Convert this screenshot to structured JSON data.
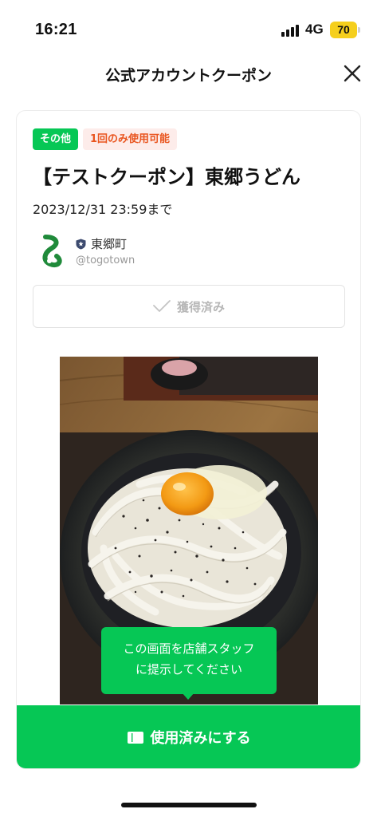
{
  "status_bar": {
    "time": "16:21",
    "network": "4G",
    "battery": "70"
  },
  "header": {
    "title": "公式アカウントクーポン",
    "close_icon": "close-icon"
  },
  "coupon": {
    "tags": [
      "その他",
      "1回のみ使用可能"
    ],
    "title": "【テストクーポン】東郷うどん",
    "expiry": "2023/12/31 23:59まで",
    "account": {
      "name": "東郷町",
      "id": "@togotown",
      "badge_icon": "shield-badge-icon"
    },
    "acquired_label": "獲得済み",
    "tooltip_line1": "この画面を店舗スタッフ",
    "tooltip_line2": "に提示してください",
    "use_button_label": "使用済みにする"
  },
  "colors": {
    "accent": "#06c755",
    "tag_orange_text": "#e9551f",
    "tag_orange_bg": "#fdecea",
    "battery": "#f5cf1d"
  }
}
